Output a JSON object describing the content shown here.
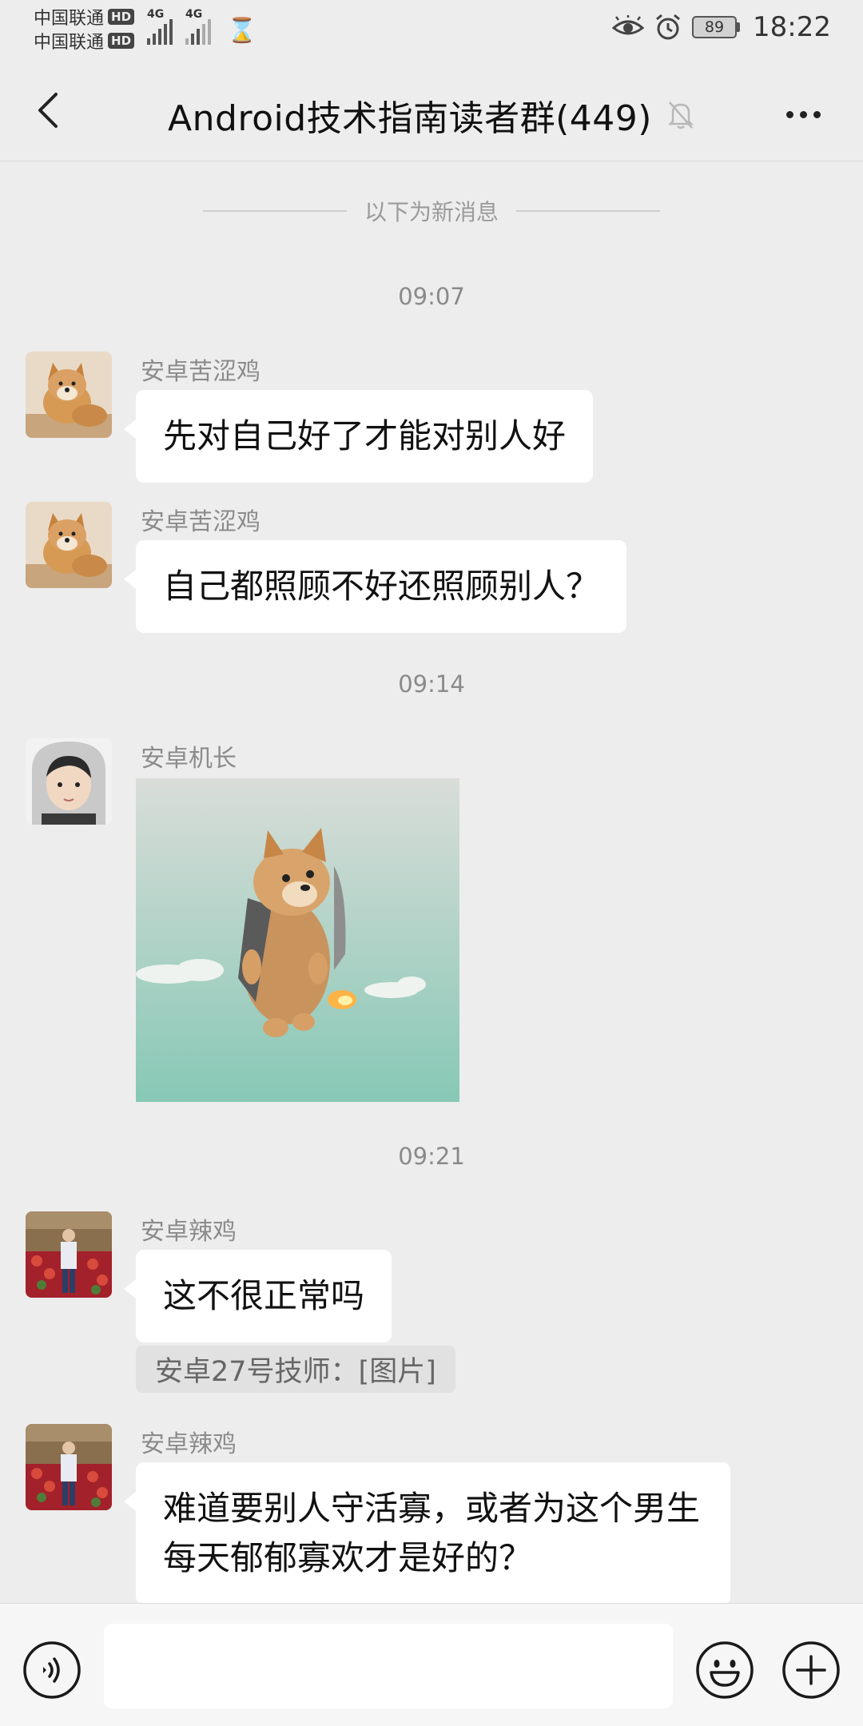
{
  "status_bar": {
    "carrier1": "中国联通",
    "carrier2": "中国联通",
    "hd_badge": "HD",
    "network1": "4G",
    "network2": "4G",
    "battery": "89",
    "time": "18:22"
  },
  "header": {
    "title": "Android技术指南读者群(449)",
    "muted": true
  },
  "chat": {
    "new_messages_divider": "以下为新消息",
    "timestamps": [
      "09:07",
      "09:14",
      "09:21"
    ],
    "messages": [
      {
        "sender": "安卓苦涩鸡",
        "type": "text",
        "text": "先对自己好了才能对别人好"
      },
      {
        "sender": "安卓苦涩鸡",
        "type": "text",
        "text": "自己都照顾不好还照顾别人？"
      },
      {
        "sender": "安卓机长",
        "type": "sticker",
        "sticker": "flying-shiba-doge-sticker"
      },
      {
        "sender": "安卓辣鸡",
        "type": "text",
        "text": "这不很正常吗",
        "quote": "安卓27号技师：[图片]"
      },
      {
        "sender": "安卓辣鸡",
        "type": "text",
        "text": "难道要别人守活寡，或者为这个男生每天郁郁寡欢才是好的？"
      }
    ]
  },
  "input_bar": {
    "value": ""
  },
  "colors": {
    "background": "#ededed",
    "bubble": "#ffffff",
    "quote_bg": "#e1e1e1",
    "muted_text": "#8b8b8b"
  }
}
